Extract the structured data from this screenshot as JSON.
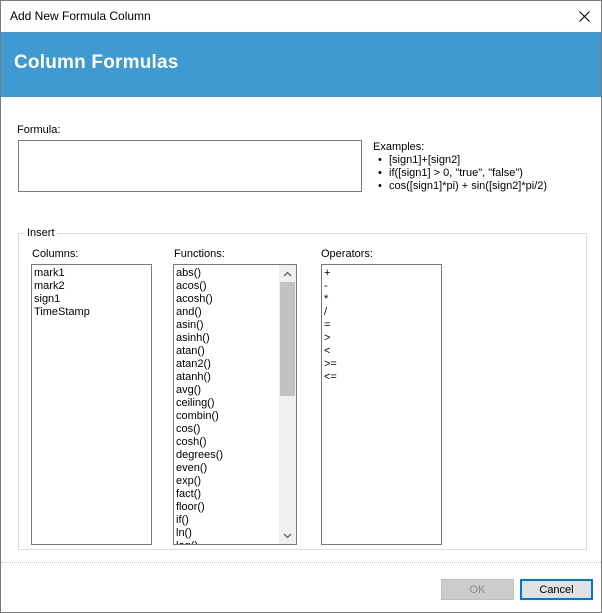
{
  "window": {
    "title": "Add New Formula Column"
  },
  "banner": {
    "heading": "Column Formulas"
  },
  "formula": {
    "label": "Formula:",
    "value": ""
  },
  "examples": {
    "label": "Examples:",
    "items": [
      "[sign1]+[sign2]",
      "if([sign1] > 0, \"true\", \"false\")",
      "cos([sign1]*pi) + sin([sign2]*pi/2)"
    ]
  },
  "insert": {
    "legend": "Insert",
    "columns": {
      "label": "Columns:",
      "items": [
        "mark1",
        "mark2",
        "sign1",
        "TimeStamp"
      ]
    },
    "functions": {
      "label": "Functions:",
      "items": [
        "abs()",
        "acos()",
        "acosh()",
        "and()",
        "asin()",
        "asinh()",
        "atan()",
        "atan2()",
        "atanh()",
        "avg()",
        "ceiling()",
        "combin()",
        "cos()",
        "cosh()",
        "degrees()",
        "even()",
        "exp()",
        "fact()",
        "floor()",
        "if()",
        "ln()",
        "log()"
      ]
    },
    "operators": {
      "label": "Operators:",
      "items": [
        "+",
        "-",
        "*",
        "/",
        "=",
        ">",
        "<",
        ">=",
        "<="
      ]
    }
  },
  "buttons": {
    "ok": "OK",
    "cancel": "Cancel"
  },
  "colors": {
    "banner": "#3f9ad1",
    "accent": "#0078d7"
  }
}
